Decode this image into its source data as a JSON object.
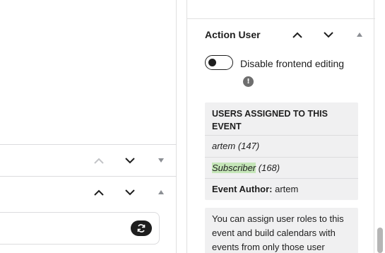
{
  "left": {
    "refresh_icon": "refresh-icon"
  },
  "panel": {
    "title": "Action User",
    "toggle": {
      "label": "Disable frontend editing",
      "checked": false
    },
    "info_glyph": "!",
    "users": {
      "heading": "USERS ASSIGNED TO THIS EVENT",
      "items": [
        {
          "name": "artem",
          "count": "(147)"
        },
        {
          "name": "Subscriber",
          "count": "(168)"
        }
      ],
      "author_label": "Event Author:",
      "author_value": "artem"
    },
    "description": "You can assign user roles to this event and build calendars with events from only those user"
  },
  "colors": {
    "highlight": "#c5e6b8",
    "box_bg": "#f0f0f1",
    "dark": "#1e1e1e"
  }
}
